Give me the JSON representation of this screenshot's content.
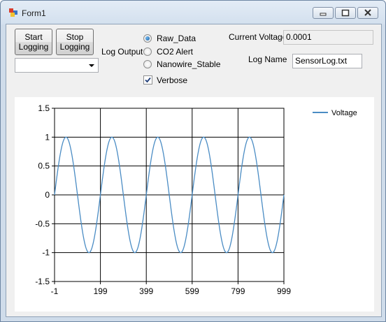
{
  "window": {
    "title": "Form1"
  },
  "buttons": {
    "start_logging": [
      "Start",
      "Logging"
    ],
    "stop_logging": [
      "Stop",
      "Logging"
    ]
  },
  "log_target_combo": {
    "value": ""
  },
  "log_output": {
    "label": "Log Output",
    "options": [
      {
        "label": "Raw_Data",
        "selected": true
      },
      {
        "label": "CO2 Alert",
        "selected": false
      },
      {
        "label": "Nanowire_Stable",
        "selected": false
      }
    ],
    "verbose": {
      "label": "Verbose",
      "checked": true
    }
  },
  "current_voltage": {
    "label": "Current Voltage:",
    "value": "0.0001"
  },
  "log_name": {
    "label": "Log Name",
    "value": "SensorLog.txt"
  },
  "colors": {
    "series": "#4a8cc4",
    "accent": "#1b5fa0"
  },
  "chart_data": {
    "type": "line",
    "xlim": [
      -1,
      999
    ],
    "ylim": [
      -1.5,
      1.5
    ],
    "x_ticks": [
      "-1",
      "199",
      "399",
      "599",
      "799",
      "999"
    ],
    "y_ticks": [
      "1.5",
      "1",
      "0.5",
      "0",
      "-0.5",
      "-1",
      "-1.5"
    ],
    "grid": true,
    "legend_position": "top-right",
    "series": [
      {
        "name": "Voltage",
        "function": "sin",
        "amplitude": 1,
        "cycles": 5,
        "x_start": -1,
        "x_end": 999
      }
    ]
  }
}
